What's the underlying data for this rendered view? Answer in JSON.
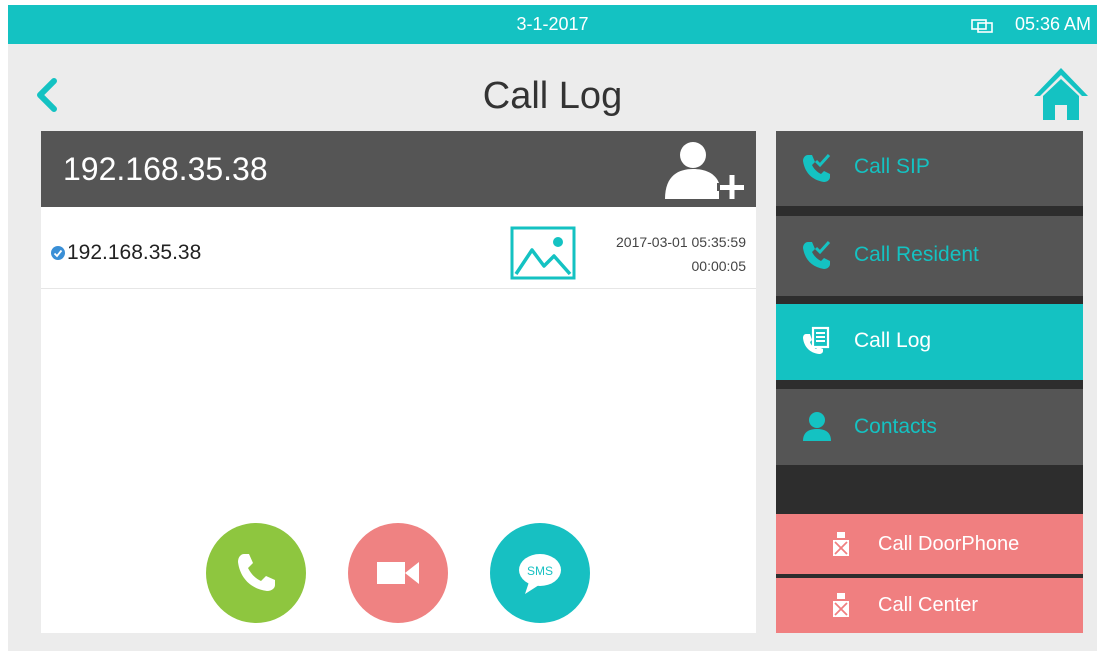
{
  "status": {
    "date": "3-1-2017",
    "time": "05:36 AM",
    "icon": "network-icon"
  },
  "header": {
    "title": "Call Log",
    "back_icon": "chevron-left-icon",
    "home_icon": "home-icon"
  },
  "dial": {
    "number": "192.168.35.38",
    "add_icon": "add-contact-icon"
  },
  "log": [
    {
      "number": "192.168.35.38",
      "datetime": "2017-03-01 05:35:59",
      "duration": "00:00:05",
      "status_icon": "check-icon",
      "snapshot_icon": "image-icon"
    }
  ],
  "actions": {
    "call_icon": "phone-icon",
    "video_icon": "video-camera-icon",
    "sms_label": "SMS"
  },
  "sidebar": {
    "items": [
      {
        "label": "Call SIP",
        "icon": "phone-check-icon"
      },
      {
        "label": "Call Resident",
        "icon": "phone-check-icon"
      },
      {
        "label": "Call Log",
        "icon": "call-log-icon"
      },
      {
        "label": "Contacts",
        "icon": "person-icon"
      }
    ],
    "bottom": [
      {
        "label": "Call DoorPhone",
        "icon": "doorphone-icon"
      },
      {
        "label": "Call Center",
        "icon": "doorphone-icon"
      }
    ]
  },
  "colors": {
    "teal": "#14c2c2",
    "dark": "#555555",
    "green": "#8ec63f",
    "pink": "#f07f80"
  }
}
